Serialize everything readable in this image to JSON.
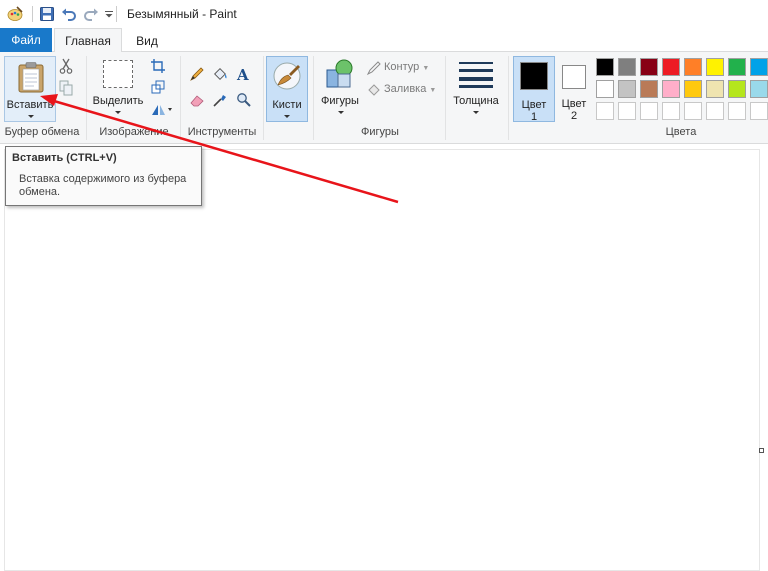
{
  "window": {
    "title": "Безымянный - Paint"
  },
  "menu_tabs": {
    "file": "Файл",
    "home": "Главная",
    "view": "Вид"
  },
  "ribbon": {
    "clipboard": {
      "paste_label": "Вставить",
      "group_label": "Буфер обмена"
    },
    "image": {
      "select_label": "Выделить",
      "group_label": "Изображение"
    },
    "tools": {
      "group_label": "Инструменты"
    },
    "brushes": {
      "label": "Кисти"
    },
    "shapes": {
      "label": "Фигуры",
      "outline_label": "Контур",
      "fill_label": "Заливка",
      "group_label": "Фигуры"
    },
    "size": {
      "label": "Толщина"
    },
    "colors": {
      "color1_label": "Цвет",
      "color1_num": "1",
      "color2_label": "Цвет",
      "color2_num": "2",
      "color1_value": "#000000",
      "color2_value": "#ffffff",
      "group_label": "Цвета",
      "palette_row1": [
        "#000000",
        "#7f7f7f",
        "#880015",
        "#ed1c24",
        "#ff7f27",
        "#fff200",
        "#22b14c",
        "#00a2e8"
      ],
      "palette_row2": [
        "#ffffff",
        "#c3c3c3",
        "#b97a57",
        "#ffaec9",
        "#ffc90e",
        "#efe4b0",
        "#b5e61d",
        "#99d9ea"
      ]
    }
  },
  "tooltip": {
    "title": "Вставить (CTRL+V)",
    "body": "Вставка содержимого из буфера обмена."
  },
  "annotation": {
    "color": "#e8141a"
  }
}
